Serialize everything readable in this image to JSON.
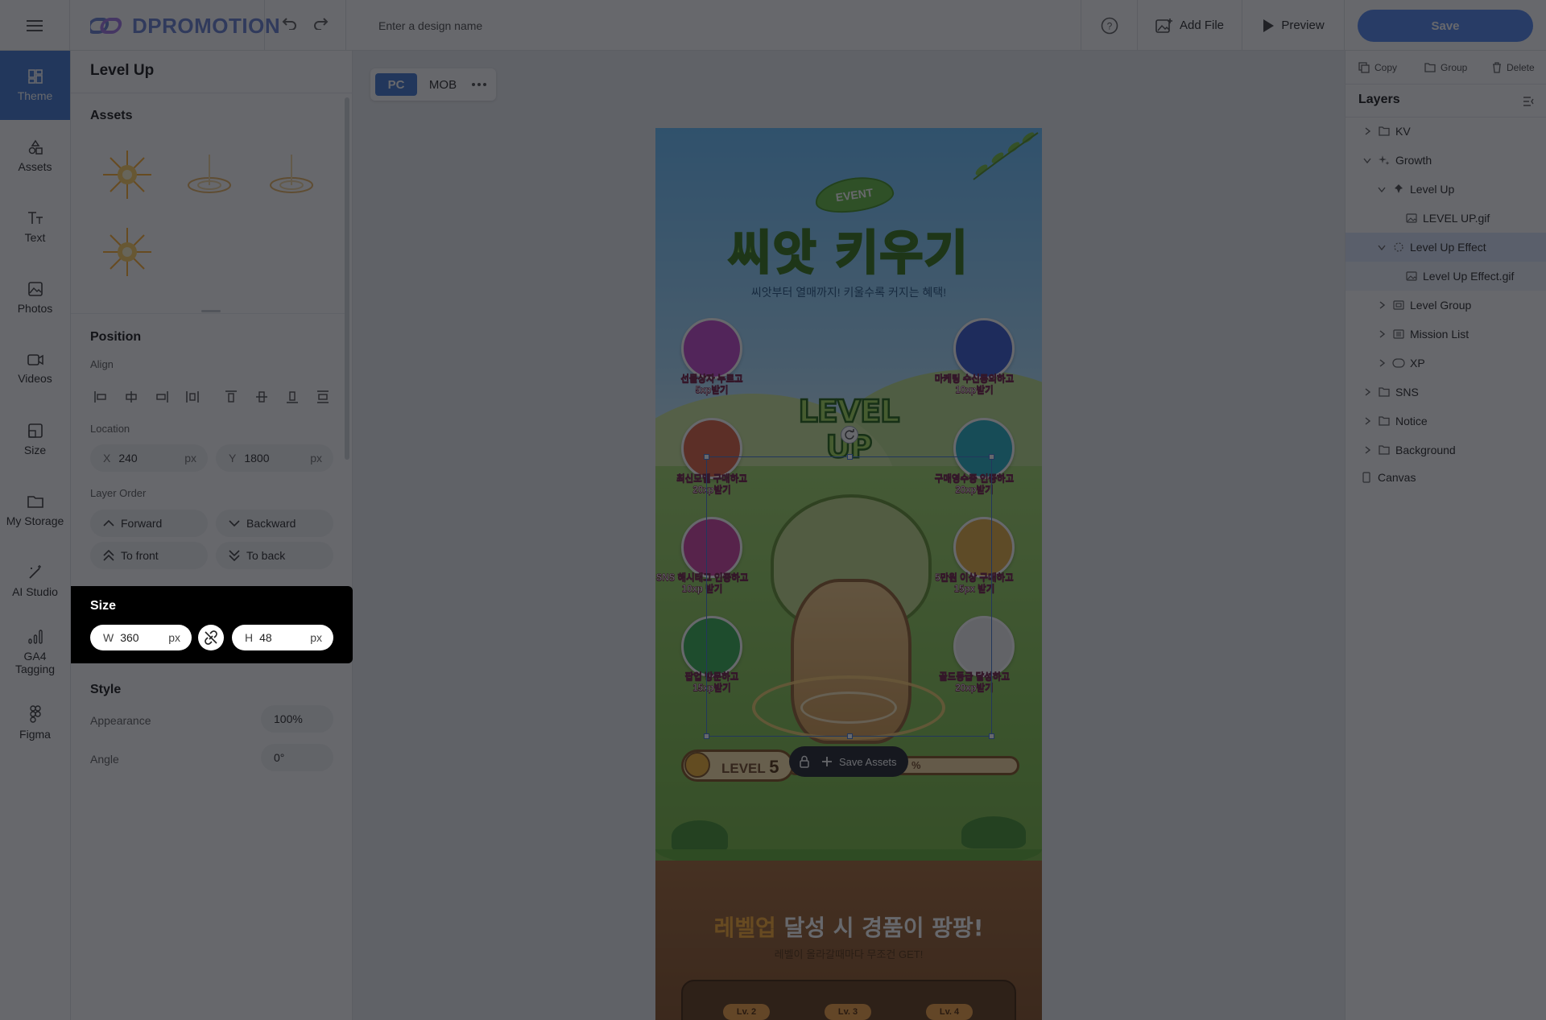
{
  "topbar": {
    "logo_text": "DPROMOTION",
    "design_name_placeholder": "Enter a design name",
    "add_file_label": "Add File",
    "preview_label": "Preview",
    "save_label": "Save"
  },
  "nav": {
    "items": [
      {
        "label": "Theme",
        "icon": "theme-icon"
      },
      {
        "label": "Assets",
        "icon": "shapes-icon"
      },
      {
        "label": "Text",
        "icon": "text-icon"
      },
      {
        "label": "Photos",
        "icon": "photo-icon"
      },
      {
        "label": "Videos",
        "icon": "video-icon"
      },
      {
        "label": "Size",
        "icon": "resize-icon"
      },
      {
        "label": "My Storage",
        "icon": "folder-icon"
      },
      {
        "label": "AI Studio",
        "icon": "magic-wand-icon"
      },
      {
        "label": "GA4 Tagging",
        "icon": "bar-chart-icon"
      },
      {
        "label": "Figma",
        "icon": "figma-icon"
      }
    ],
    "active": "Theme"
  },
  "panel": {
    "title": "Level Up",
    "assets_title": "Assets",
    "position_title": "Position",
    "align_label": "Align",
    "location_label": "Location",
    "x_label": "X",
    "x_value": "240",
    "y_label": "Y",
    "y_value": "1800",
    "unit": "px",
    "layer_order_label": "Layer Order",
    "forward": "Forward",
    "backward": "Backward",
    "to_front": "To front",
    "to_back": "To back",
    "size_title": "Size",
    "w_label": "W",
    "w_value": "360",
    "h_label": "H",
    "h_value": "48",
    "style_title": "Style",
    "appearance_label": "Appearance",
    "appearance_value": "100%",
    "angle_label": "Angle",
    "angle_value": "0°"
  },
  "canvas": {
    "device_pc": "PC",
    "device_mob": "MOB",
    "event_badge": "EVENT",
    "hero_title": "씨앗 키우기",
    "hero_subtitle": "씨앗부터 열매까지! 키울수록 커지는 혜택!",
    "levelup_text": "LEVEL UP",
    "missions": [
      {
        "label": "선물상자 누르고\n5xp받기"
      },
      {
        "label": "마케팅 수신동의하고\n10xp받기"
      },
      {
        "label": "최신모델 구매하고\n20xp받기"
      },
      {
        "label": "구매영수증 인증하고\n20xp받기"
      },
      {
        "label": "SNS 해시태그 인증하고\n10xp 받기"
      },
      {
        "label": "5만원 이상 구매하고\n15px 받기"
      },
      {
        "label": "팝업 방문하고\n15xp받기"
      },
      {
        "label": "골드등급 달성하고\n20xp받기"
      }
    ],
    "level_label": "LEVEL",
    "level_number": "5",
    "level_percent": "%",
    "level_progress": 0.42,
    "save_assets_label": "Save Assets",
    "reward_title_highlight": "레벨업",
    "reward_title_rest": " 달성 시 경품이 팡팡!",
    "reward_subtitle": "레벨이 올라갈때마다 무조건 GET!",
    "level_tags": [
      "Lv. 2",
      "Lv. 3",
      "Lv. 4"
    ]
  },
  "rpanel": {
    "copy": "Copy",
    "group": "Group",
    "delete": "Delete",
    "layers_title": "Layers",
    "layers": [
      {
        "label": "KV",
        "icon": "folder-icon",
        "depth": 0,
        "state": "collapsed"
      },
      {
        "label": "Growth",
        "icon": "sparkle-icon",
        "depth": 0,
        "state": "expanded"
      },
      {
        "label": "Level Up",
        "icon": "pin-icon",
        "depth": 1,
        "state": "expanded"
      },
      {
        "label": "LEVEL UP.gif",
        "icon": "image-icon",
        "depth": 2,
        "state": "leaf"
      },
      {
        "label": "Level Up Effect",
        "icon": "effect-icon",
        "depth": 1,
        "state": "expanded",
        "selected": true
      },
      {
        "label": "Level Up Effect.gif",
        "icon": "image-icon",
        "depth": 2,
        "state": "leaf"
      },
      {
        "label": "Level Group",
        "icon": "group-icon",
        "depth": 1,
        "state": "collapsed"
      },
      {
        "label": "Mission List",
        "icon": "list-icon",
        "depth": 1,
        "state": "collapsed"
      },
      {
        "label": "XP",
        "icon": "xp-icon",
        "depth": 1,
        "state": "collapsed"
      },
      {
        "label": "SNS",
        "icon": "folder-icon",
        "depth": 0,
        "state": "collapsed"
      },
      {
        "label": "Notice",
        "icon": "folder-icon",
        "depth": 0,
        "state": "collapsed"
      },
      {
        "label": "Background",
        "icon": "folder-icon",
        "depth": 0,
        "state": "collapsed"
      },
      {
        "label": "Canvas",
        "icon": "canvas-icon",
        "depth": 0,
        "state": "none"
      }
    ]
  },
  "colors": {
    "accent": "#4a7fd4",
    "save": "#5b8def",
    "overlay": "rgba(10,12,18,0.62)"
  }
}
